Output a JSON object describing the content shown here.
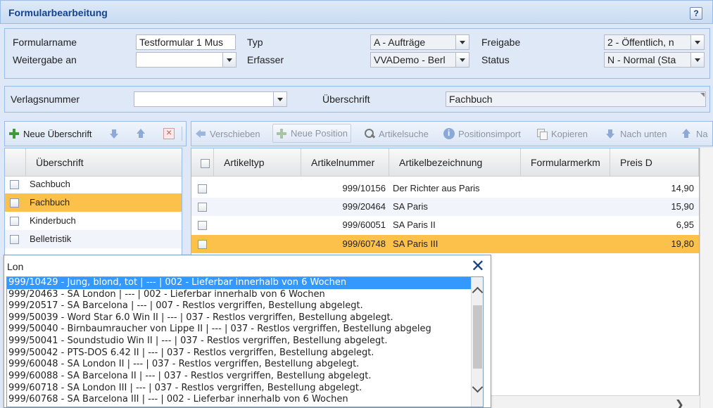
{
  "window": {
    "title": "Formularbearbeitung",
    "help_label": "?"
  },
  "form": {
    "formularname_label": "Formularname",
    "formularname_value": "Testformular 1 Mus",
    "typ_label": "Typ",
    "typ_value": "A - Aufträge",
    "freigabe_label": "Freigabe",
    "freigabe_value": "2 - Öffentlich, n",
    "weitergabe_label": "Weitergabe an",
    "weitergabe_value": "",
    "erfasser_label": "Erfasser",
    "erfasser_value": "VVADemo - Berl",
    "status_label": "Status",
    "status_value": "N - Normal (Sta",
    "verlagsnummer_label": "Verlagsnummer",
    "verlagsnummer_value": "",
    "ueberschrift_label": "Überschrift",
    "ueberschrift_value": "Fachbuch"
  },
  "toolbar_left": {
    "neue_ueberschrift": "Neue Überschrift"
  },
  "toolbar_right": {
    "verschieben": "Verschieben",
    "neue_position": "Neue Position",
    "artikelsuche": "Artikelsuche",
    "positionsimport": "Positionsimport",
    "kopieren": "Kopieren",
    "nach_unten": "Nach unten",
    "nach_oben": "Na"
  },
  "headings_grid": {
    "column": "Überschrift",
    "rows": [
      "Sachbuch",
      "Fachbuch",
      "Kinderbuch",
      "Belletristik"
    ],
    "selected_index": 1
  },
  "articles_grid": {
    "columns": [
      "Artikeltyp",
      "Artikelnummer",
      "Artikelbezeichnung",
      "Formularmerkm",
      "Preis D"
    ],
    "rows": [
      {
        "typ": "",
        "nummer": "999/10156",
        "bezeichnung": "Der Richter aus Paris",
        "merkmal": "",
        "preis": "14,90"
      },
      {
        "typ": "",
        "nummer": "999/20464",
        "bezeichnung": "SA Paris",
        "merkmal": "",
        "preis": "15,90"
      },
      {
        "typ": "",
        "nummer": "999/60051",
        "bezeichnung": "SA Paris II",
        "merkmal": "",
        "preis": "6,95"
      },
      {
        "typ": "",
        "nummer": "999/60748",
        "bezeichnung": "SA Paris III",
        "merkmal": "",
        "preis": "19,80"
      }
    ],
    "selected_index": 3
  },
  "popup": {
    "search_value": "Lon",
    "items": [
      "999/10429 - Jung, blond, tot | --- | 002 - Lieferbar innerhalb von 6 Wochen",
      "999/20463 - SA London | --- | 002 - Lieferbar innerhalb von 6 Wochen",
      "999/20517 - SA Barcelona | --- | 007 - Restlos vergriffen, Bestellung abgelegt.",
      "999/50039 - Word Star 6.0 Win II | --- | 037 - Restlos vergriffen, Bestellung abgelegt.",
      "999/50040 - Birnbaumraucher von Lippe II | --- | 037 - Restlos vergriffen, Bestellung abgeleg",
      "999/50041 - Soundstudio Win II | --- | 037 - Restlos vergriffen, Bestellung abgelegt.",
      "999/50042 - PTS-DOS 6.42 II | --- | 037 - Restlos vergriffen, Bestellung abgelegt.",
      "999/60048 - SA London II | --- | 037 - Restlos vergriffen, Bestellung abgelegt.",
      "999/60088 - SA Barcelona II | --- | 037 - Restlos vergriffen, Bestellung abgelegt.",
      "999/60718 - SA London III | --- | 037 - Restlos vergriffen, Bestellung abgelegt.",
      "999/60768 - SA Barcelona III | --- | 002 - Lieferbar innerhalb von 6 Wochen"
    ],
    "selected_index": 0
  },
  "colors": {
    "selection": "#fbc14a",
    "list_selection": "#3399ff",
    "title": "#15428b"
  }
}
